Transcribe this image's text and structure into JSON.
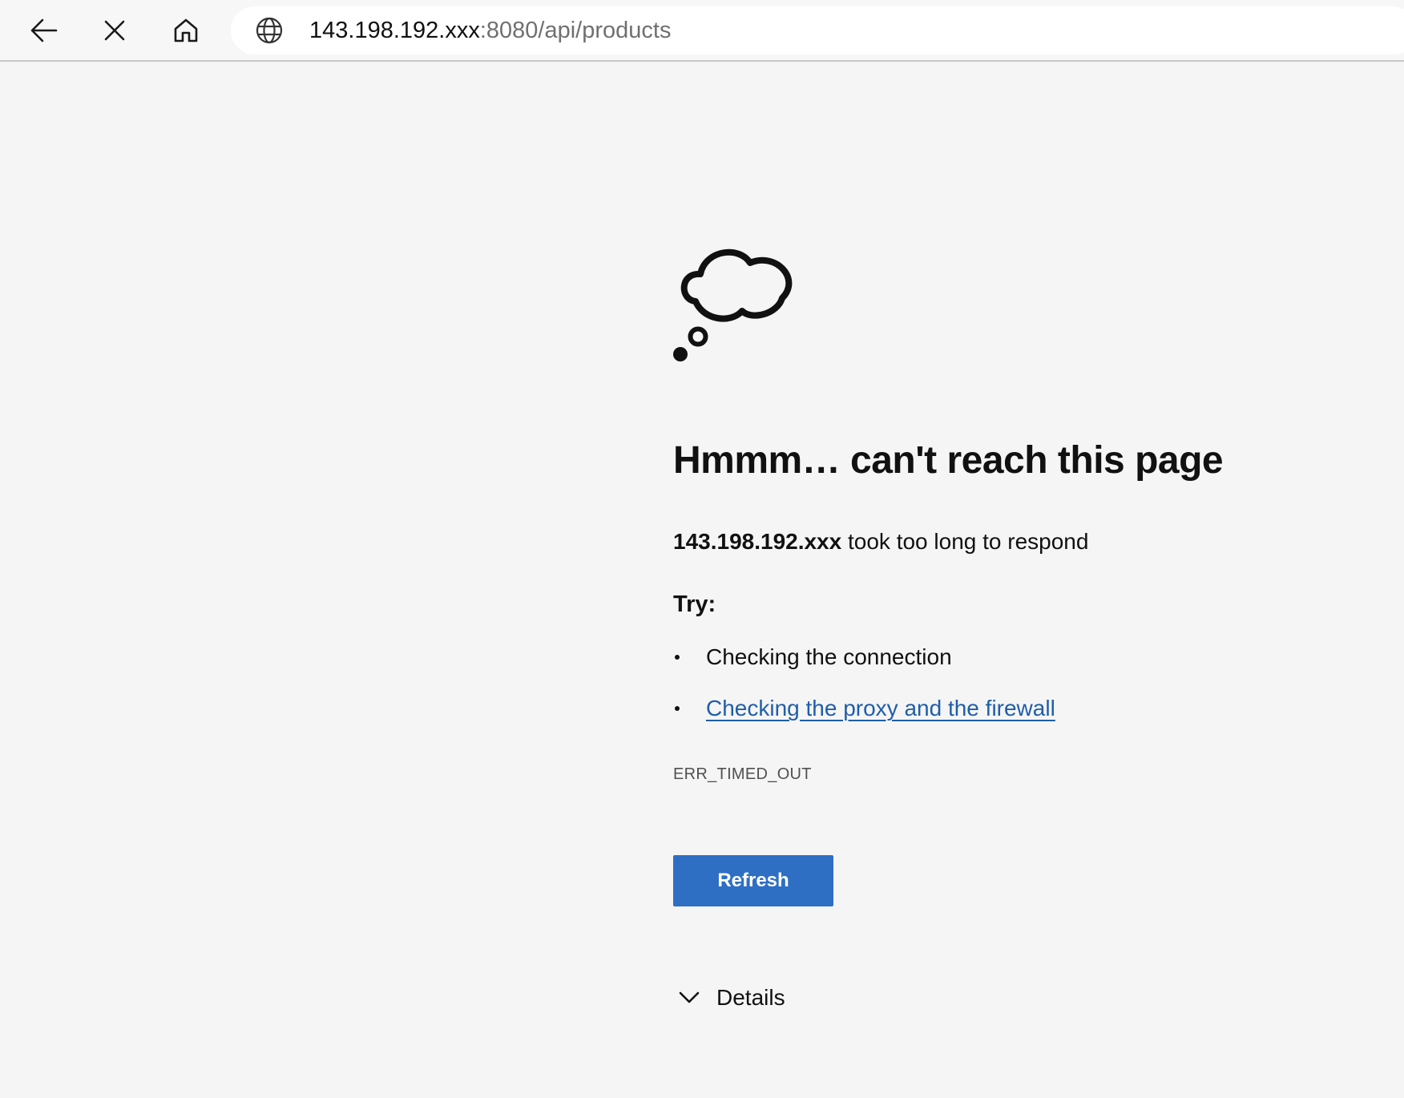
{
  "toolbar": {
    "back_icon": "arrow-left-icon",
    "stop_icon": "close-icon",
    "home_icon": "home-icon"
  },
  "address_bar": {
    "icon": "globe-icon",
    "url_host": "143.198.192.xxx",
    "url_path": ":8080/api/products"
  },
  "error_page": {
    "illustration_icon": "thought-cloud-icon",
    "headline": "Hmmm… can't reach this page",
    "host": "143.198.192.xxx",
    "summary_rest": " took too long to respond",
    "try_label": "Try:",
    "suggestions": [
      {
        "text": "Checking the connection",
        "is_link": false
      },
      {
        "text": "Checking the proxy and the firewall",
        "is_link": true
      }
    ],
    "error_code": "ERR_TIMED_OUT",
    "refresh_label": "Refresh",
    "details_label": "Details",
    "details_icon": "chevron-down-icon"
  },
  "colors": {
    "background": "#f5f5f5",
    "text": "#111111",
    "link": "#1f5ea8",
    "button": "#2e6fc4",
    "button_text": "#ffffff",
    "url_path": "#707070",
    "error_code": "#505050"
  }
}
